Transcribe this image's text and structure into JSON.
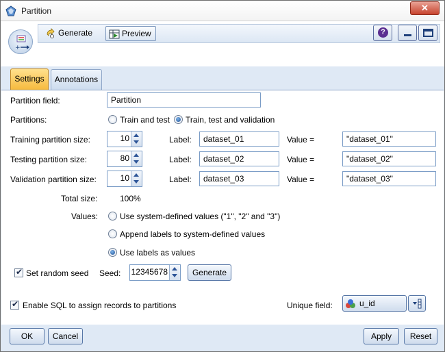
{
  "window": {
    "title": "Partition",
    "close_label": "✕"
  },
  "toolbar": {
    "generate_label": "Generate",
    "preview_label": "Preview",
    "help_label": "?"
  },
  "tabs": [
    {
      "label": "Settings",
      "active": true
    },
    {
      "label": "Annotations",
      "active": false
    }
  ],
  "form": {
    "partition_field_label": "Partition field:",
    "partition_field_value": "Partition",
    "partitions_label": "Partitions:",
    "partitions_options": [
      {
        "label": "Train and test",
        "selected": false
      },
      {
        "label": "Train, test and validation",
        "selected": true
      }
    ],
    "rows": [
      {
        "label": "Training partition size:",
        "size": "10",
        "label_caption": "Label:",
        "label_value": "dataset_01",
        "value_caption": "Value =",
        "value": "\"dataset_01\""
      },
      {
        "label": "Testing partition size:",
        "size": "80",
        "label_caption": "Label:",
        "label_value": "dataset_02",
        "value_caption": "Value =",
        "value": "\"dataset_02\""
      },
      {
        "label": "Validation partition size:",
        "size": "10",
        "label_caption": "Label:",
        "label_value": "dataset_03",
        "value_caption": "Value =",
        "value": "\"dataset_03\""
      }
    ],
    "total_size_label": "Total size:",
    "total_size_value": "100%",
    "values_label": "Values:",
    "values_options": [
      {
        "label": "Use system-defined values (\"1\", \"2\" and \"3\")",
        "selected": false
      },
      {
        "label": "Append labels to system-defined values",
        "selected": false
      },
      {
        "label": "Use labels as values",
        "selected": true
      }
    ],
    "random_seed": {
      "checkbox_label": "Set random seed",
      "checked": true,
      "seed_label": "Seed:",
      "seed_value": "12345678",
      "generate_label": "Generate"
    },
    "sql": {
      "checkbox_label": "Enable SQL to assign records to partitions",
      "checked": true,
      "unique_field_label": "Unique field:",
      "unique_field_value": "u_id"
    }
  },
  "buttons": {
    "ok": "OK",
    "cancel": "Cancel",
    "apply": "Apply",
    "reset": "Reset"
  }
}
